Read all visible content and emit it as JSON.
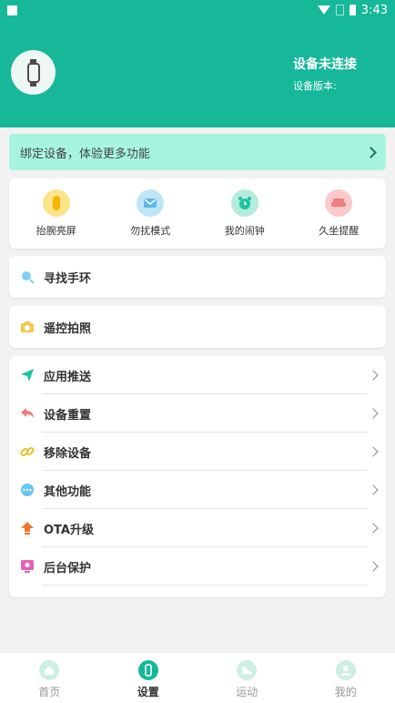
{
  "status_bar": {
    "time": "3:43"
  },
  "header": {
    "device_status": "设备未连接",
    "device_version_label": "设备版本:"
  },
  "bind_banner": {
    "text": "绑定设备，体验更多功能"
  },
  "quick_actions": [
    {
      "label": "抬腕亮屏",
      "icon": "raise-wrist-icon",
      "color": "#fbe48a"
    },
    {
      "label": "勿扰模式",
      "icon": "do-not-disturb-icon",
      "color": "#bfe5f7"
    },
    {
      "label": "我的闹钟",
      "icon": "alarm-clock-icon",
      "color": "#b5ecdc"
    },
    {
      "label": "久坐提醒",
      "icon": "sedentary-icon",
      "color": "#fbc9c9"
    }
  ],
  "find_band": {
    "label": "寻找手环",
    "icon": "search-icon"
  },
  "remote_photo": {
    "label": "遥控拍照",
    "icon": "camera-icon"
  },
  "settings_list": [
    {
      "label": "应用推送",
      "icon": "send-icon",
      "color": "#1fc3a0"
    },
    {
      "label": "设备重置",
      "icon": "reset-icon",
      "color": "#f07c7c"
    },
    {
      "label": "移除设备",
      "icon": "link-icon",
      "color": "#e8c02e"
    },
    {
      "label": "其他功能",
      "icon": "more-icon",
      "color": "#66c7f0"
    },
    {
      "label": "OTA升级",
      "icon": "upgrade-icon",
      "color": "#f0762e"
    },
    {
      "label": "后台保护",
      "icon": "protect-icon",
      "color": "#e65fb8"
    }
  ],
  "tabbar": [
    {
      "label": "首页",
      "icon": "home-icon"
    },
    {
      "label": "设置",
      "icon": "settings-watch-icon",
      "active": true
    },
    {
      "label": "运动",
      "icon": "sport-shoe-icon"
    },
    {
      "label": "我的",
      "icon": "profile-icon"
    }
  ]
}
